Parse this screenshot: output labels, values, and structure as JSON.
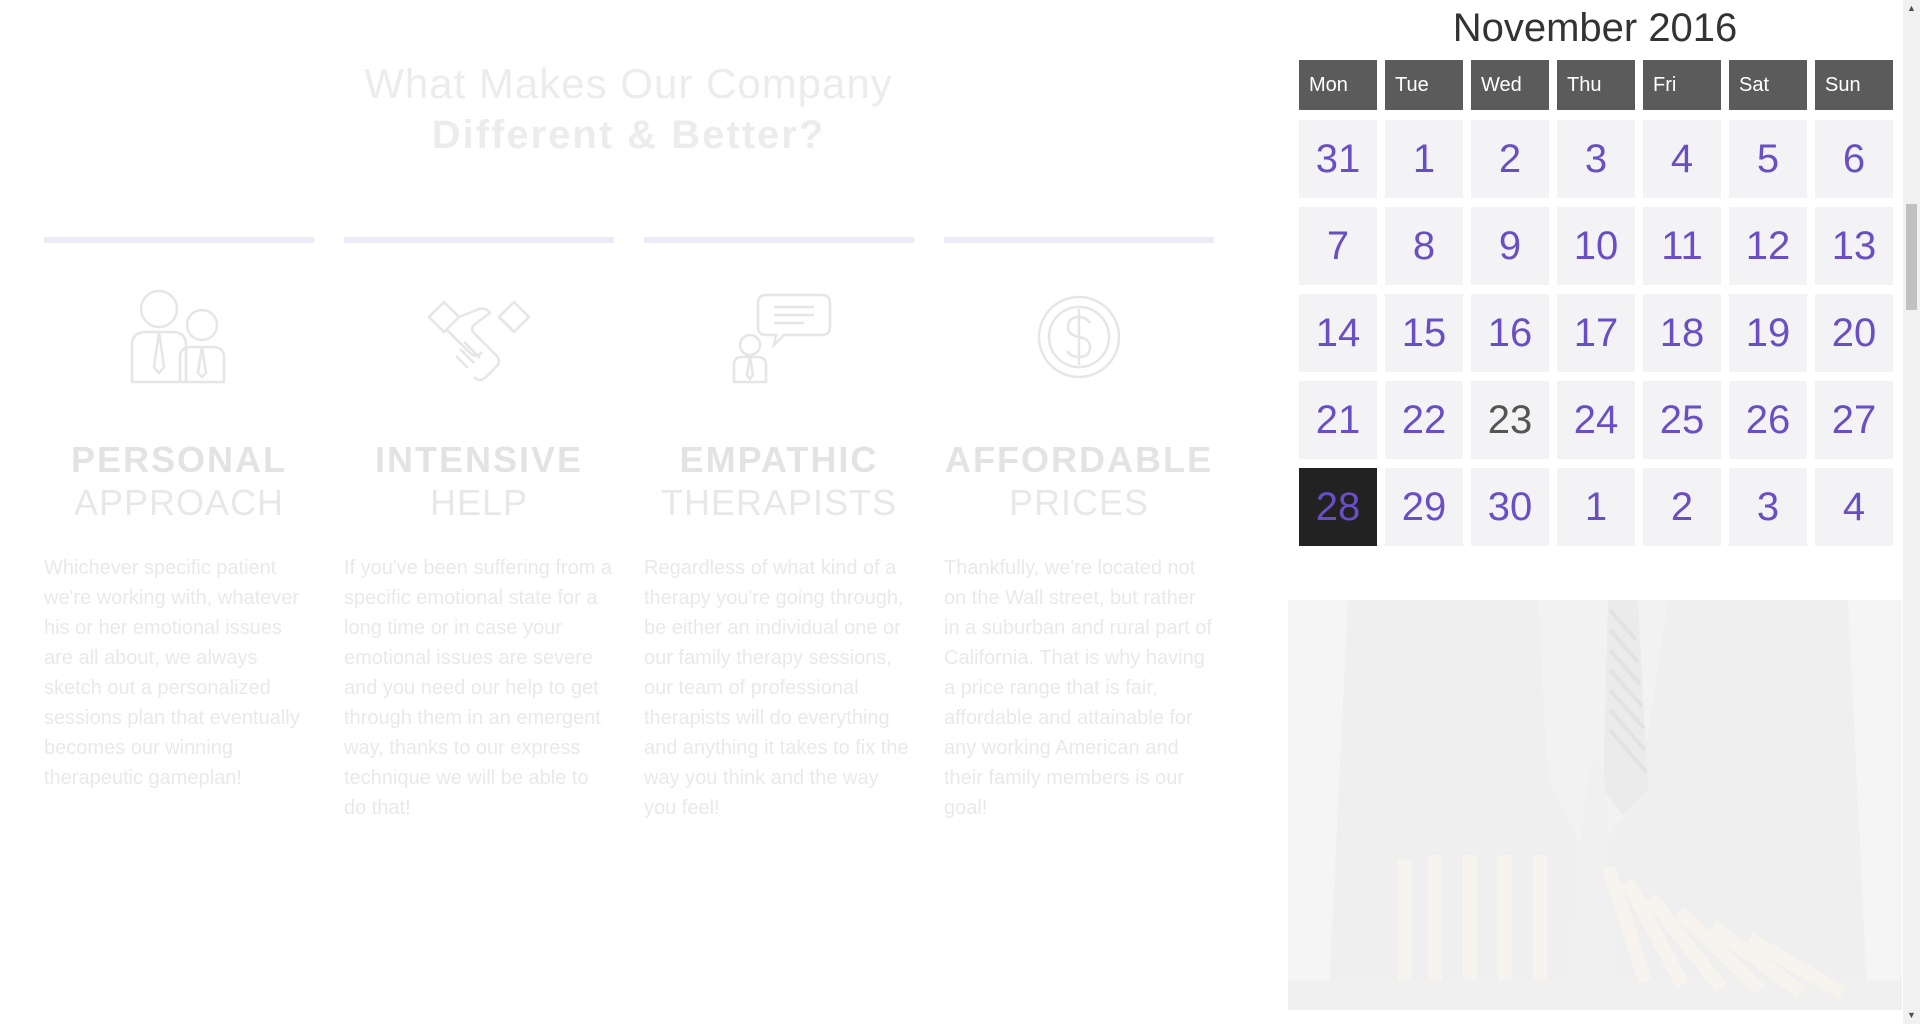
{
  "section": {
    "heading_line1": "What Makes Our Company",
    "heading_line2": "Different & Better?"
  },
  "features": [
    {
      "icon": "people-icon",
      "title_bold": "PERSONAL",
      "title_light": "APPROACH",
      "description": "Whichever specific patient we're working with, whatever  his or her emotional issues are all about, we always sketch out a personalized sessions plan that eventually becomes our winning therapeutic gameplan!"
    },
    {
      "icon": "handshake-icon",
      "title_bold": "INTENSIVE",
      "title_light": "HELP",
      "description": "If you've been suffering from a specific emotional state for a long time or in case your emotional issues are severe and you need our help to get through them in an emergent way, thanks to our express technique we will be able to do that!"
    },
    {
      "icon": "chat-person-icon",
      "title_bold": "EMPATHIC",
      "title_light": "THERAPISTS",
      "description": "Regardless of what kind of a therapy you're going through, be either an individual one or our family therapy sessions, our team of professional therapists will do everything and anything it takes to fix the way you think and the way you feel!"
    },
    {
      "icon": "dollar-coin-icon",
      "title_bold": "AFFORDABLE",
      "title_light": "PRICES",
      "description": "Thankfully, we're located not on the Wall street, but rather in a suburban and rural part of California. That is why having a price range that is fair, affordable and attainable for any working American and their family members is our goal!"
    }
  ],
  "calendar": {
    "title": "November 2016",
    "weekdays": [
      "Mon",
      "Tue",
      "Wed",
      "Thu",
      "Fri",
      "Sat",
      "Sun"
    ],
    "weeks": [
      [
        "31",
        "1",
        "2",
        "3",
        "4",
        "5",
        "6"
      ],
      [
        "7",
        "8",
        "9",
        "10",
        "11",
        "12",
        "13"
      ],
      [
        "14",
        "15",
        "16",
        "17",
        "18",
        "19",
        "20"
      ],
      [
        "21",
        "22",
        "23",
        "24",
        "25",
        "26",
        "27"
      ],
      [
        "28",
        "29",
        "30",
        "1",
        "2",
        "3",
        "4"
      ]
    ],
    "today": "23",
    "selected": "28",
    "colors": {
      "header_bg": "#5b5b5b",
      "cell_bg": "#f3f2f5",
      "day_text": "#6a4fc4",
      "selected_bg": "#222222"
    }
  },
  "photo": {
    "subject": "businessman-hand-stopping-falling-dominoes"
  }
}
